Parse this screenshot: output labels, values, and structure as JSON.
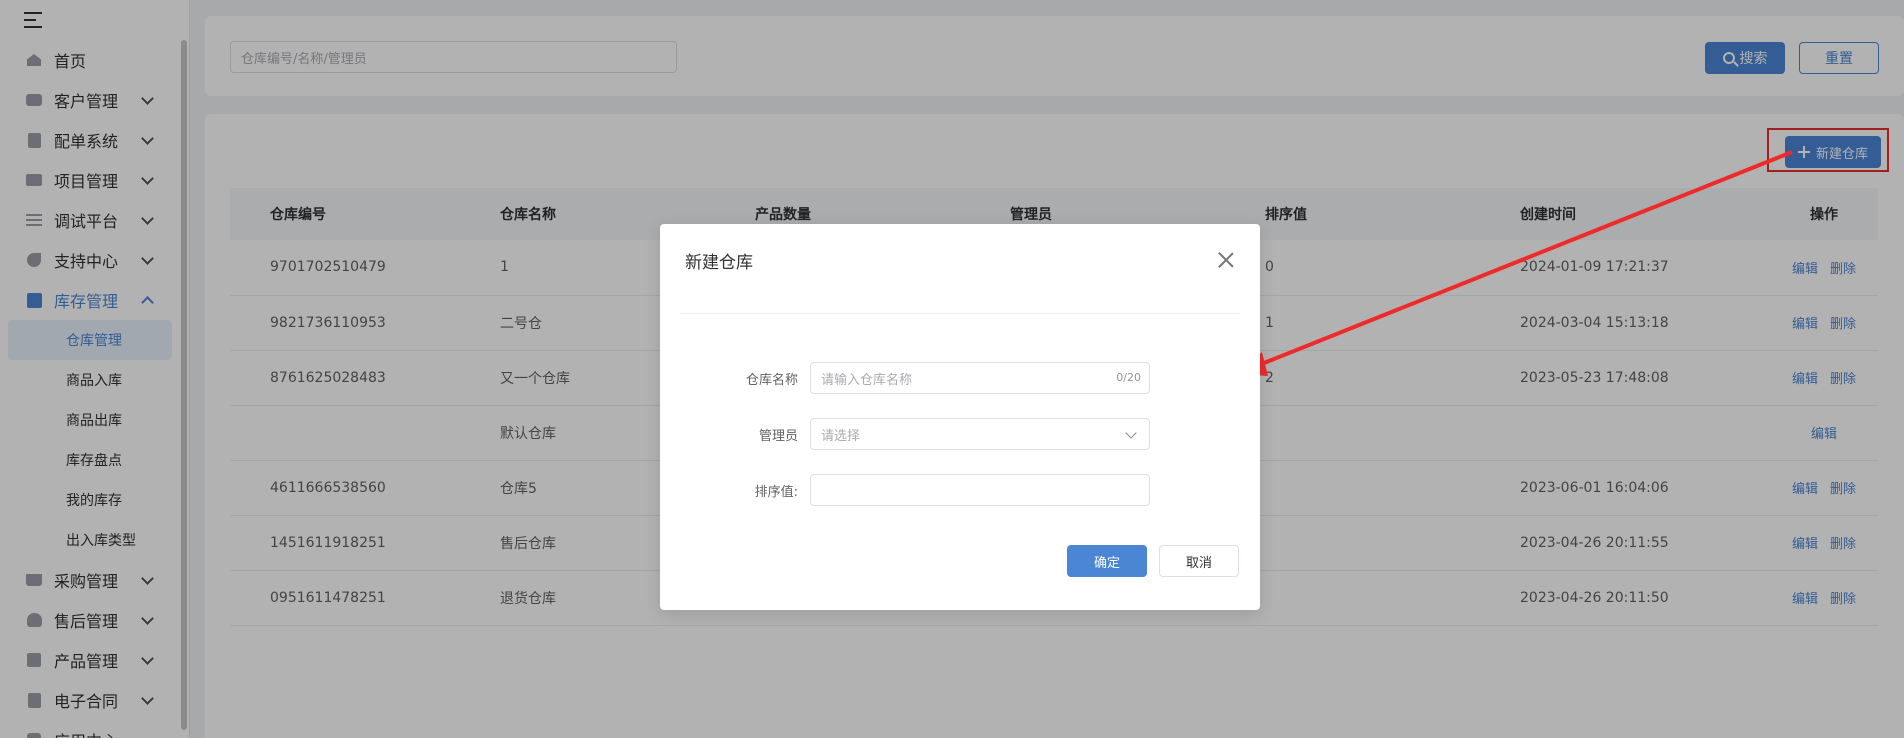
{
  "sidebar": {
    "items": [
      {
        "label": "首页",
        "icon": "home-icon",
        "has_arrow": false
      },
      {
        "label": "客户管理",
        "icon": "customer-icon",
        "has_arrow": true
      },
      {
        "label": "配单系统",
        "icon": "document-icon",
        "has_arrow": true
      },
      {
        "label": "项目管理",
        "icon": "folder-icon",
        "has_arrow": true
      },
      {
        "label": "调试平台",
        "icon": "sliders-icon",
        "has_arrow": true
      },
      {
        "label": "支持中心",
        "icon": "wrench-icon",
        "has_arrow": true
      },
      {
        "label": "库存管理",
        "icon": "inventory-icon",
        "has_arrow": true,
        "open": true
      },
      {
        "label": "采购管理",
        "icon": "cart-icon",
        "has_arrow": true
      },
      {
        "label": "售后管理",
        "icon": "headset-icon",
        "has_arrow": true
      },
      {
        "label": "产品管理",
        "icon": "box-icon",
        "has_arrow": true
      },
      {
        "label": "电子合同",
        "icon": "contract-icon",
        "has_arrow": true
      },
      {
        "label": "应用中心",
        "icon": "apps-icon",
        "has_arrow": false
      }
    ],
    "inventory_sub": [
      "仓库管理",
      "商品入库",
      "商品出库",
      "库存盘点",
      "我的库存",
      "出入库类型"
    ],
    "selected_sub": "仓库管理"
  },
  "search": {
    "placeholder": "仓库编号/名称/管理员",
    "search_label": "搜索",
    "reset_label": "重置"
  },
  "toolbar": {
    "new_label": "新建仓库"
  },
  "table": {
    "headers": [
      "仓库编号",
      "仓库名称",
      "产品数量",
      "管理员",
      "排序值",
      "创建时间",
      "操作"
    ],
    "rows": [
      {
        "code": "9701702510479",
        "name": "1",
        "sort": "0",
        "created": "2024-01-09 17:21:37",
        "ops": [
          "编辑",
          "删除"
        ]
      },
      {
        "code": "9821736110953",
        "name": "二号仓",
        "sort": "1",
        "created": "2024-03-04 15:13:18",
        "ops": [
          "编辑",
          "删除"
        ]
      },
      {
        "code": "8761625028483",
        "name": "又一个仓库",
        "sort": "2",
        "created": "2023-05-23 17:48:08",
        "ops": [
          "编辑",
          "删除"
        ]
      },
      {
        "code": "",
        "name": "默认仓库",
        "sort": "",
        "created": "",
        "ops": [
          "编辑"
        ]
      },
      {
        "code": "4611666538560",
        "name": "仓库5",
        "sort": "",
        "created": "2023-06-01 16:04:06",
        "ops": [
          "编辑",
          "删除"
        ]
      },
      {
        "code": "1451611918251",
        "name": "售后仓库",
        "sort": "",
        "created": "2023-04-26 20:11:55",
        "ops": [
          "编辑",
          "删除"
        ]
      },
      {
        "code": "0951611478251",
        "name": "退货仓库",
        "sort": "",
        "created": "2023-04-26 20:11:50",
        "ops": [
          "编辑",
          "删除"
        ]
      }
    ]
  },
  "dialog": {
    "title": "新建仓库",
    "name_label": "仓库名称",
    "name_placeholder": "请输入仓库名称",
    "name_counter": "0/20",
    "manager_label": "管理员",
    "manager_placeholder": "请选择",
    "sort_label": "排序值:",
    "ok_label": "确定",
    "cancel_label": "取消"
  },
  "colors": {
    "accent": "#4a86d4",
    "annotation": "#ee2a2a"
  }
}
